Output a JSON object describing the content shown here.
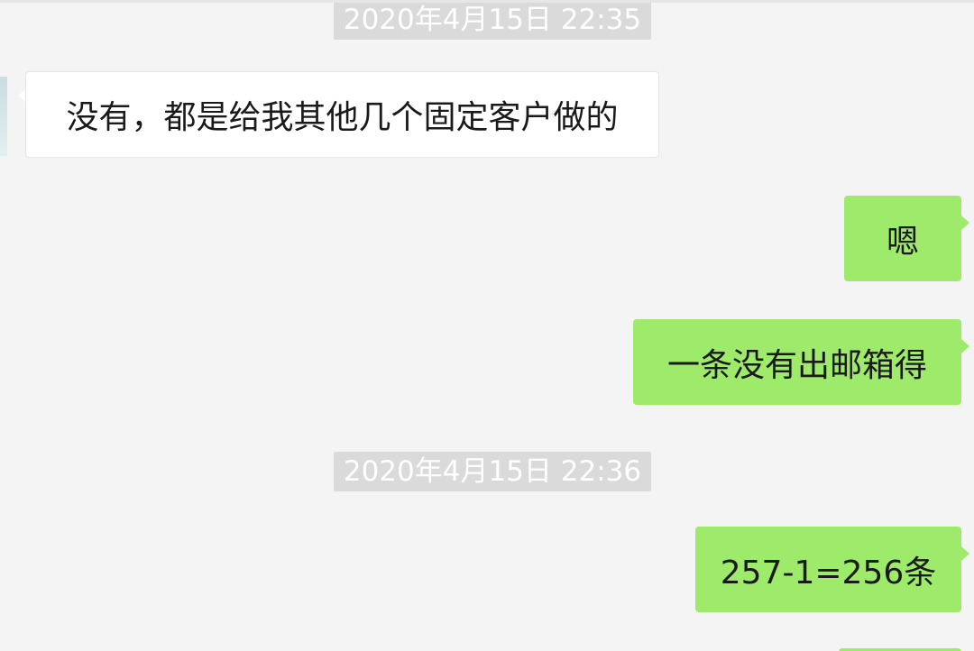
{
  "messages": [
    {
      "type": "timestamp",
      "text": "2020年4月15日 22:35"
    },
    {
      "type": "incoming",
      "text": "没有，都是给我其他几个固定客户做的"
    },
    {
      "type": "outgoing",
      "text": "嗯"
    },
    {
      "type": "outgoing",
      "text": "一条没有出邮箱得"
    },
    {
      "type": "timestamp",
      "text": "2020年4月15日 22:36"
    },
    {
      "type": "outgoing",
      "text": "257-1=256条"
    }
  ],
  "colors": {
    "background": "#f4f4f4",
    "incoming_bubble": "#ffffff",
    "outgoing_bubble": "#9eea6a",
    "timestamp_bg": "#dadada",
    "timestamp_text": "#ffffff"
  }
}
